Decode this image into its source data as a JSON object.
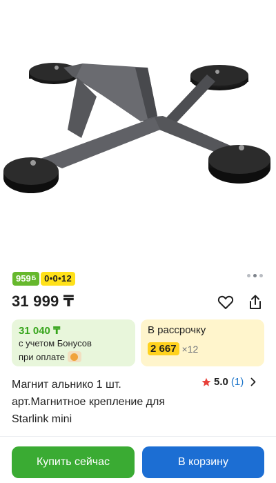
{
  "gallery": {
    "image": "magnetic-mount-product-photo",
    "page_count": 3,
    "active_page": 1
  },
  "badges": {
    "bonus_value": "959",
    "bonus_unit": "Б",
    "installment": "0•0•12"
  },
  "price": {
    "current": "31 999 ₸"
  },
  "actions": {
    "favorite_icon": "heart-icon",
    "share_icon": "share-icon"
  },
  "bonus_card": {
    "amount": "31 040 ₸",
    "line1": "с учетом Бонусов",
    "line2": "при оплате"
  },
  "installment_card": {
    "title": "В рассрочку",
    "monthly": "2 667",
    "multiplier": "×12"
  },
  "product": {
    "title": "Магнит альнико 1 шт. арт.Магнитное крепление для Starlink mini"
  },
  "rating": {
    "value": "5.0",
    "count": "(1)"
  },
  "buttons": {
    "buy_now": "Купить сейчас",
    "add_to_cart": "В корзину"
  },
  "colors": {
    "green": "#3aab33",
    "blue": "#1c6ed3",
    "yellow": "#ffe11a",
    "bonus_green": "#66b82d"
  }
}
